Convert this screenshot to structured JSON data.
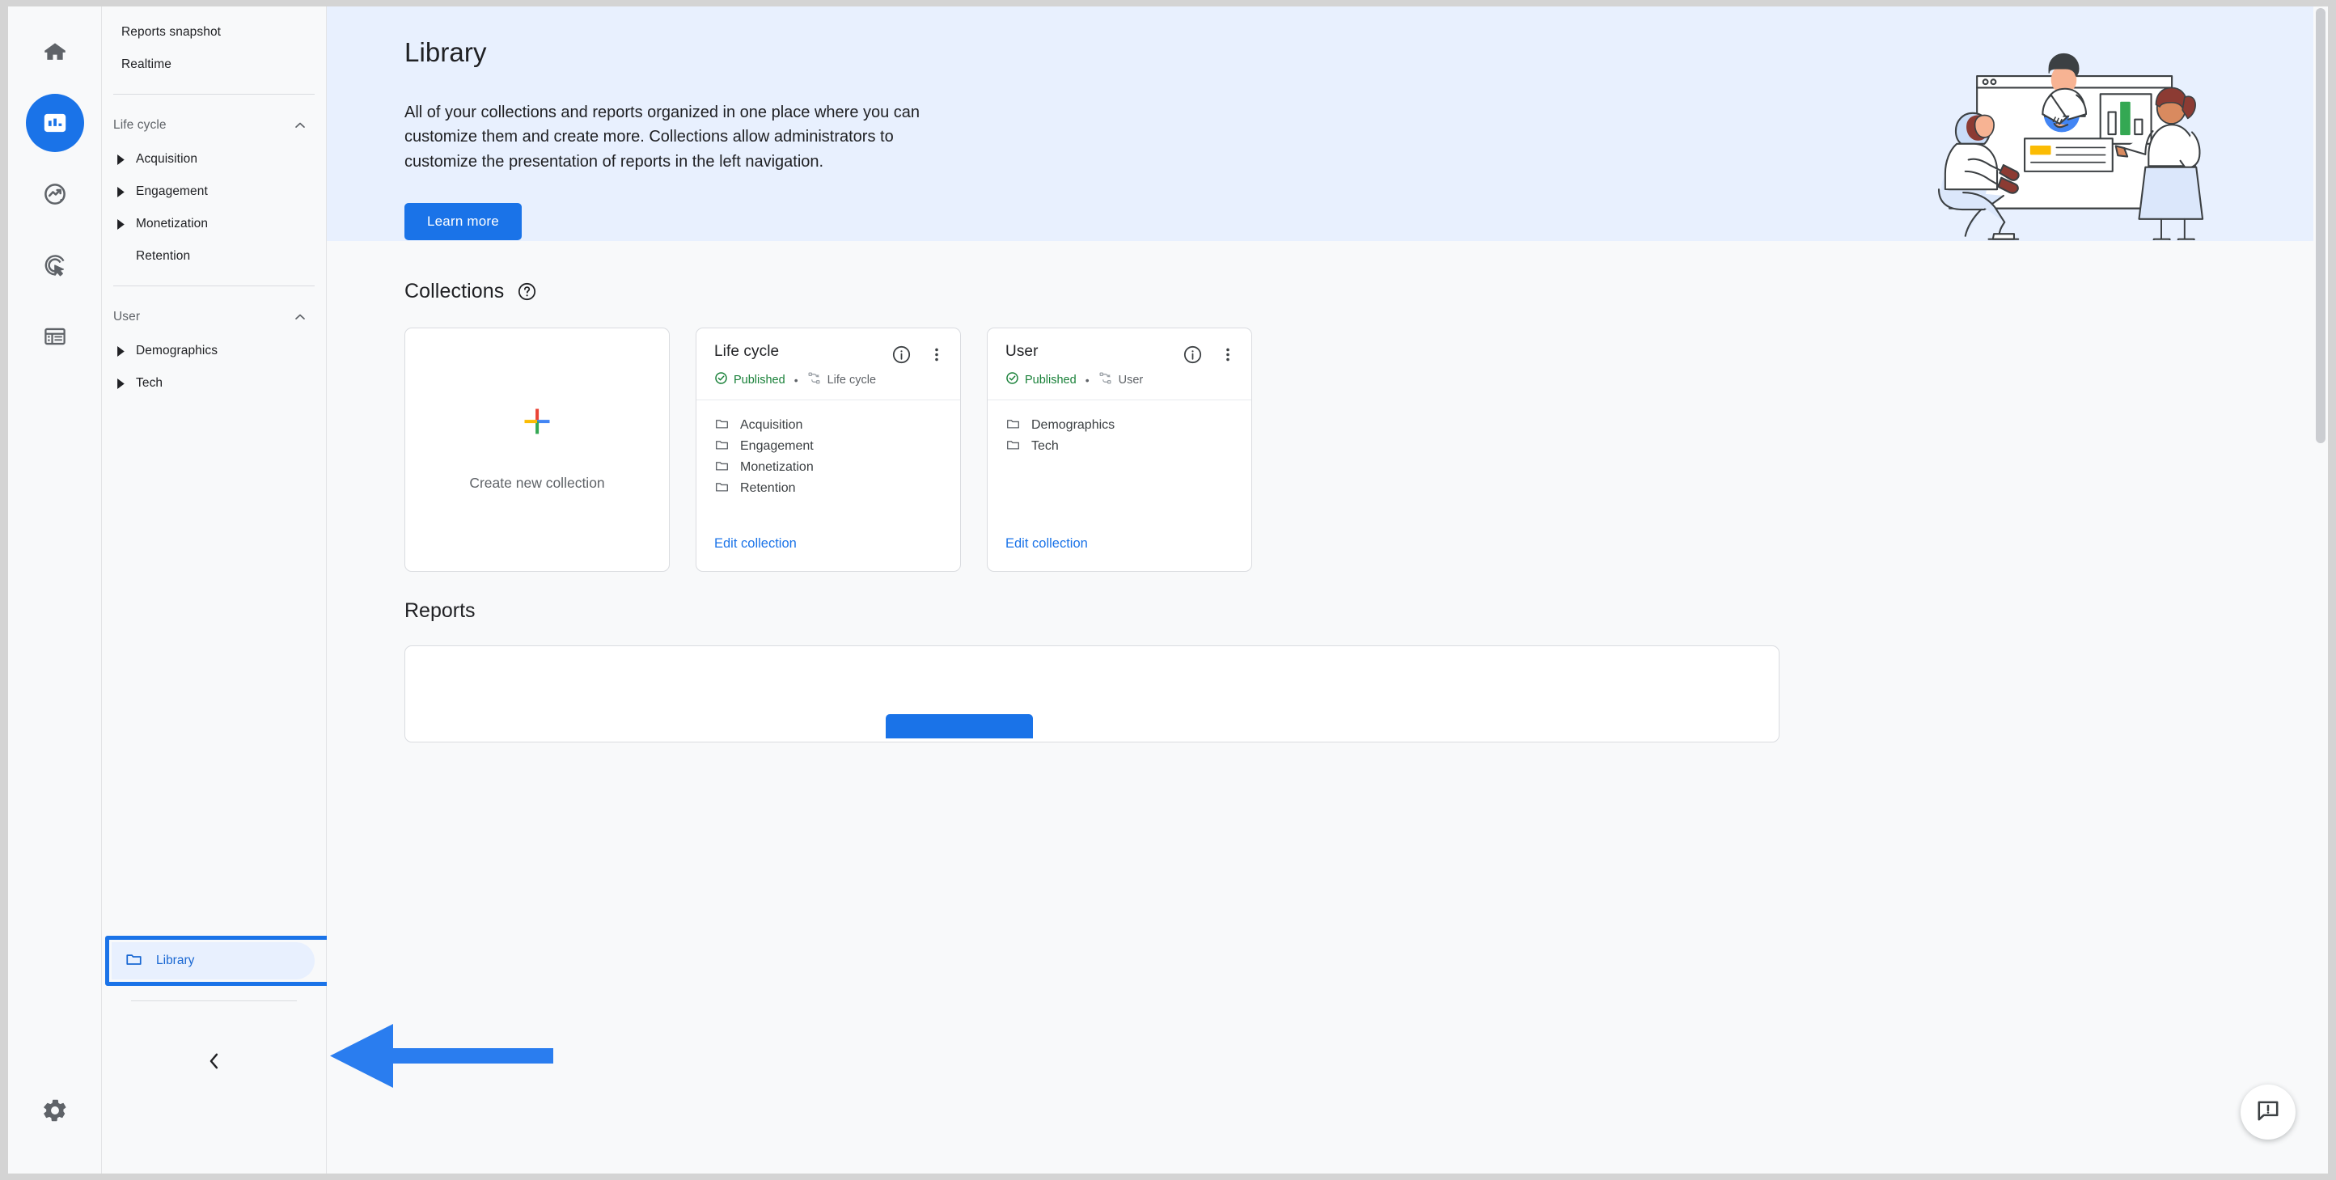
{
  "rail": {
    "items": [
      {
        "name": "home-icon",
        "label": "Home",
        "active": false
      },
      {
        "name": "reports-bar-chart-icon",
        "label": "Reports",
        "active": true
      },
      {
        "name": "explore-icon",
        "label": "Explore",
        "active": false
      },
      {
        "name": "advertising-icon",
        "label": "Advertising",
        "active": false
      },
      {
        "name": "library-list-icon",
        "label": "Library",
        "active": false
      }
    ],
    "settings_label": "Admin"
  },
  "nav": {
    "top_items": [
      {
        "label": "Reports snapshot"
      },
      {
        "label": "Realtime"
      }
    ],
    "groups": [
      {
        "label": "Life cycle",
        "expanded": true,
        "items": [
          {
            "label": "Acquisition",
            "expandable": true
          },
          {
            "label": "Engagement",
            "expandable": true
          },
          {
            "label": "Monetization",
            "expandable": true
          },
          {
            "label": "Retention",
            "expandable": false
          }
        ]
      },
      {
        "label": "User",
        "expanded": true,
        "items": [
          {
            "label": "Demographics",
            "expandable": true
          },
          {
            "label": "Tech",
            "expandable": true
          }
        ]
      }
    ],
    "library_label": "Library",
    "collapse_label": "Collapse navigation"
  },
  "hero": {
    "title": "Library",
    "description": "All of your collections and reports organized in one place where you can customize them and create more. Collections allow administrators to customize the presentation of reports in the left navigation.",
    "learn_more_label": "Learn more"
  },
  "collections": {
    "section_title": "Collections",
    "help_tooltip": "Learn about collections",
    "create_card": {
      "label": "Create new collection"
    },
    "cards": [
      {
        "title": "Life cycle",
        "status": "Published",
        "topology": "Life cycle",
        "folders": [
          "Acquisition",
          "Engagement",
          "Monetization",
          "Retention"
        ],
        "edit_label": "Edit collection"
      },
      {
        "title": "User",
        "status": "Published",
        "topology": "User",
        "folders": [
          "Demographics",
          "Tech"
        ],
        "edit_label": "Edit collection"
      }
    ]
  },
  "reports": {
    "section_title": "Reports"
  },
  "feedback": {
    "label": "Send feedback"
  },
  "colors": {
    "accent_blue": "#1a73e8",
    "hero_bg": "#e8f0fe",
    "published_green": "#188038",
    "page_bg": "#f8f9fa",
    "google_red": "#ea4335",
    "google_yellow": "#fbbc04",
    "google_green": "#34a853",
    "google_blue": "#4285f4"
  }
}
